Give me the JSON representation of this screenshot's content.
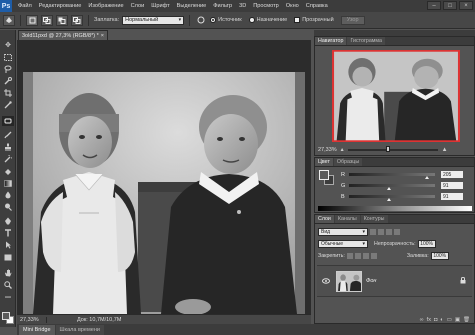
{
  "app": {
    "logo": "Ps"
  },
  "menu": [
    "Файл",
    "Редактирование",
    "Изображение",
    "Слои",
    "Шрифт",
    "Выделение",
    "Фильтр",
    "3D",
    "Просмотр",
    "Окно",
    "Справка"
  ],
  "window_controls": [
    "–",
    "□",
    "×"
  ],
  "options": {
    "mode_label": "Заплатка:",
    "mode_value": "Нормальный",
    "source_label": "Источник",
    "dest_label": "Назначение",
    "transparent_label": "Прозрачный",
    "use_pattern_label": "Узор"
  },
  "document": {
    "tab_title": "3old11pxd @ 27,3% (RGB/8*) *",
    "tab_close": "×",
    "zoom": "27,33%",
    "info": "Док: 10,7M/10,7M"
  },
  "bottom_tabs": [
    "Mini Bridge",
    "Шкала времени"
  ],
  "navigator": {
    "tabs": [
      "Навигатор",
      "Гистограмма"
    ],
    "zoom": "27,33%",
    "zoom_fraction": 0.44
  },
  "color_panel": {
    "tabs": [
      "Цвет",
      "Образцы"
    ],
    "channels": [
      {
        "label": "R",
        "value": "205",
        "pos": 0.9
      },
      {
        "label": "G",
        "value": "91",
        "pos": 0.45
      },
      {
        "label": "B",
        "value": "91",
        "pos": 0.45
      }
    ]
  },
  "layers": {
    "tabs": [
      "Слои",
      "Каналы",
      "Контуры"
    ],
    "filter": "Вид",
    "blend_mode": "Обычные",
    "opacity_label": "Непрозрачность:",
    "opacity": "100%",
    "lock_label": "Закрепить:",
    "fill_label": "Заливка:",
    "fill": "100%",
    "layer_name": "Фон"
  }
}
